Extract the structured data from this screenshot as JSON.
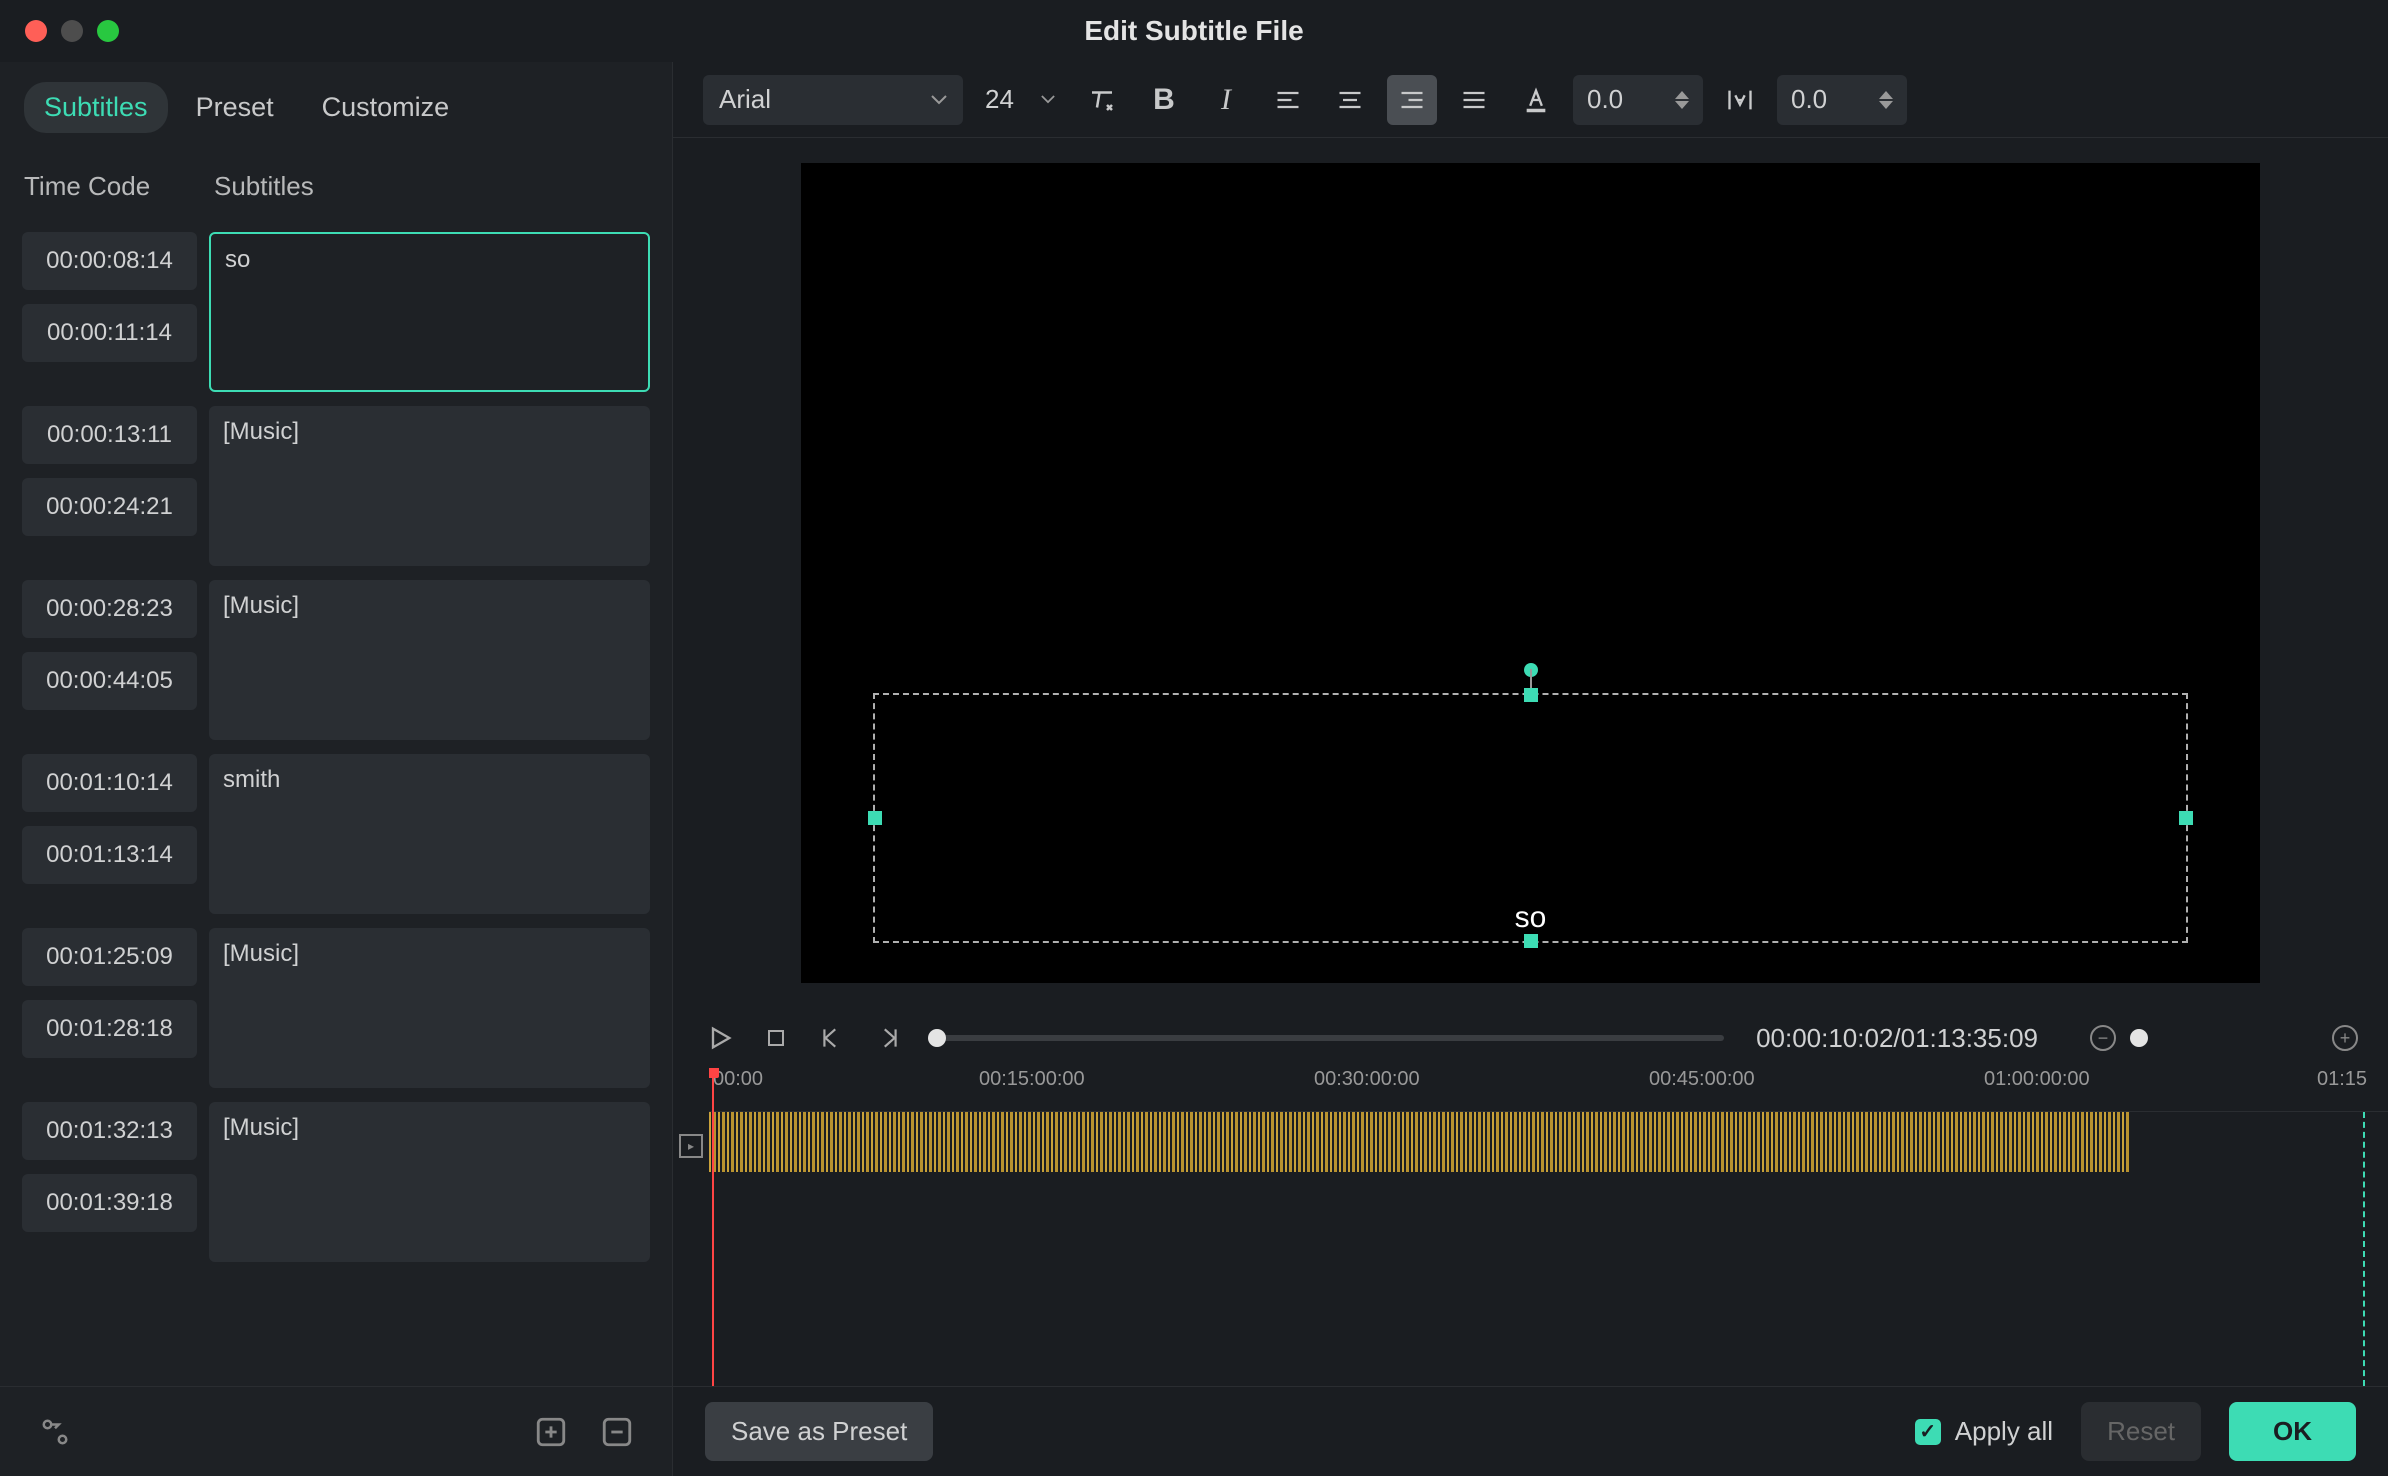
{
  "window": {
    "title": "Edit Subtitle File"
  },
  "leftTabs": [
    "Subtitles",
    "Preset",
    "Customize"
  ],
  "columns": {
    "time": "Time Code",
    "sub": "Subtitles"
  },
  "rows": [
    {
      "start": "00:00:08:14",
      "end": "00:00:11:14",
      "text": "so",
      "active": true
    },
    {
      "start": "00:00:13:11",
      "end": "00:00:24:21",
      "text": "[Music]",
      "active": false
    },
    {
      "start": "00:00:28:23",
      "end": "00:00:44:05",
      "text": "[Music]",
      "active": false
    },
    {
      "start": "00:01:10:14",
      "end": "00:01:13:14",
      "text": "smith",
      "active": false
    },
    {
      "start": "00:01:25:09",
      "end": "00:01:28:18",
      "text": "[Music]",
      "active": false
    },
    {
      "start": "00:01:32:13",
      "end": "00:01:39:18",
      "text": "[Music]",
      "active": false
    }
  ],
  "toolbar": {
    "font": "Arial",
    "size": "24",
    "charSpacing": "0.0",
    "lineSpacing": "0.0"
  },
  "preview": {
    "subtitle": "so"
  },
  "playback": {
    "time": "00:00:10:02/01:13:35:09"
  },
  "timeline": {
    "ticks": [
      "00:00",
      "00:15:00:00",
      "00:30:00:00",
      "00:45:00:00",
      "01:00:00:00",
      "01:15"
    ]
  },
  "footer": {
    "savePreset": "Save as Preset",
    "applyAll": "Apply all",
    "reset": "Reset",
    "ok": "OK"
  }
}
